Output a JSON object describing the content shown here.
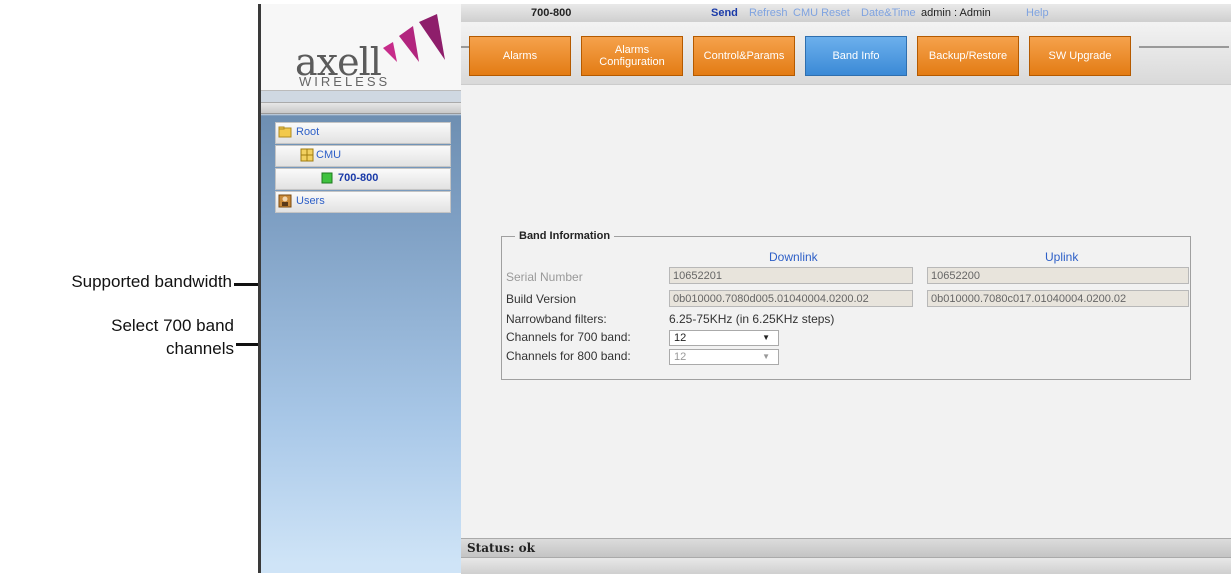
{
  "callouts": {
    "supported_bandwidth": "Supported bandwidth",
    "select_700": "Select 700 band channels"
  },
  "sidebar": {
    "logo_text": "axell",
    "logo_sub": "WIRELESS",
    "tree": [
      {
        "label": "Root",
        "icon": "folder-icon"
      },
      {
        "label": "CMU",
        "icon": "module-icon"
      },
      {
        "label": "700-800",
        "icon": "green-status-icon"
      },
      {
        "label": "Users",
        "icon": "users-icon"
      }
    ]
  },
  "topbar": {
    "device": "700-800",
    "send": "Send",
    "refresh": "Refresh",
    "cmu_reset": "CMU Reset",
    "date_time": "Date&Time",
    "user": "admin : Admin",
    "help": "Help"
  },
  "tabs": [
    {
      "label": "Alarms"
    },
    {
      "label": "Alarms Configuration"
    },
    {
      "label": "Control&Params"
    },
    {
      "label": "Band Info",
      "active": true
    },
    {
      "label": "Backup/Restore"
    },
    {
      "label": "SW Upgrade"
    }
  ],
  "band_info": {
    "legend": "Band Information",
    "downlink": "Downlink",
    "uplink": "Uplink",
    "rows": {
      "serial_label": "Serial Number",
      "serial_dl": "10652201",
      "serial_ul": "10652200",
      "build_label": "Build Version",
      "build_dl": "0b010000.7080d005.01040004.0200.02",
      "build_ul": "0b010000.7080c017.01040004.0200.02",
      "narrowband_label": "Narrowband filters:",
      "narrowband_value": "6.25-75KHz (in 6.25KHz steps)",
      "ch700_label": "Channels for 700 band:",
      "ch700_value": "12",
      "ch800_label": "Channels for 800 band:",
      "ch800_value": "12"
    }
  },
  "status": {
    "text": "Status: ok"
  },
  "colors": {
    "tab_orange": "#e37c14",
    "tab_active_blue": "#3b8ad6",
    "link_blue": "#2d5fc7"
  }
}
